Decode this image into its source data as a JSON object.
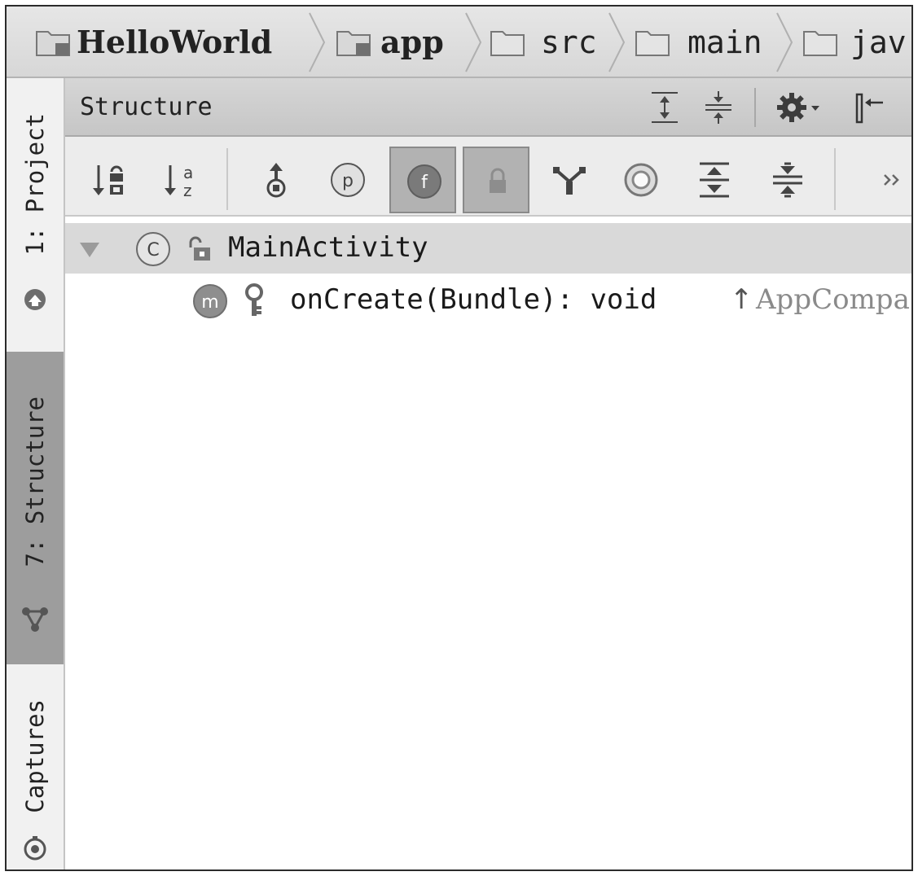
{
  "breadcrumb": {
    "items": [
      {
        "label": "HelloWorld"
      },
      {
        "label": "app"
      },
      {
        "label": "src"
      },
      {
        "label": "main"
      },
      {
        "label": "jav"
      }
    ]
  },
  "sidebar": {
    "tabs": [
      {
        "label": "1: Project",
        "icon": "project-icon",
        "active": false
      },
      {
        "label": "7: Structure",
        "icon": "structure-icon",
        "active": true
      },
      {
        "label": "Captures",
        "icon": "captures-icon",
        "active": false
      }
    ]
  },
  "panel": {
    "title": "Structure",
    "header_icons": [
      "expand-all-icon",
      "collapse-all-icon",
      "gear-icon",
      "hide-panel-icon"
    ]
  },
  "toolbar": {
    "buttons": [
      {
        "icon": "sort-by-visibility-icon",
        "toggled": false
      },
      {
        "icon": "sort-alphabetically-icon",
        "toggled": false
      },
      {
        "icon": "show-inherited-icon",
        "toggled": false
      },
      {
        "icon": "show-properties-icon",
        "label": "p",
        "toggled": false
      },
      {
        "icon": "show-fields-icon",
        "label": "f",
        "toggled": true
      },
      {
        "icon": "show-non-public-icon",
        "toggled": true
      },
      {
        "icon": "show-lambdas-icon",
        "toggled": false
      },
      {
        "icon": "autoscroll-icon",
        "toggled": false
      },
      {
        "icon": "expand-all-icon",
        "toggled": false
      },
      {
        "icon": "collapse-all-icon",
        "toggled": false
      },
      {
        "icon": "more-icon",
        "toggled": false
      }
    ]
  },
  "tree": {
    "class_node": {
      "badge": "C",
      "name": "MainActivity"
    },
    "method_node": {
      "badge": "m",
      "signature": "onCreate(Bundle): void",
      "inherited_arrow": "↑",
      "inherited_from": "AppCompa"
    }
  },
  "colors": {
    "bar_bg": "#dcdcdc",
    "active_tab": "#9d9d9d",
    "selected_row": "#d9d9d9",
    "toggled_button": "#b2b2b2"
  }
}
